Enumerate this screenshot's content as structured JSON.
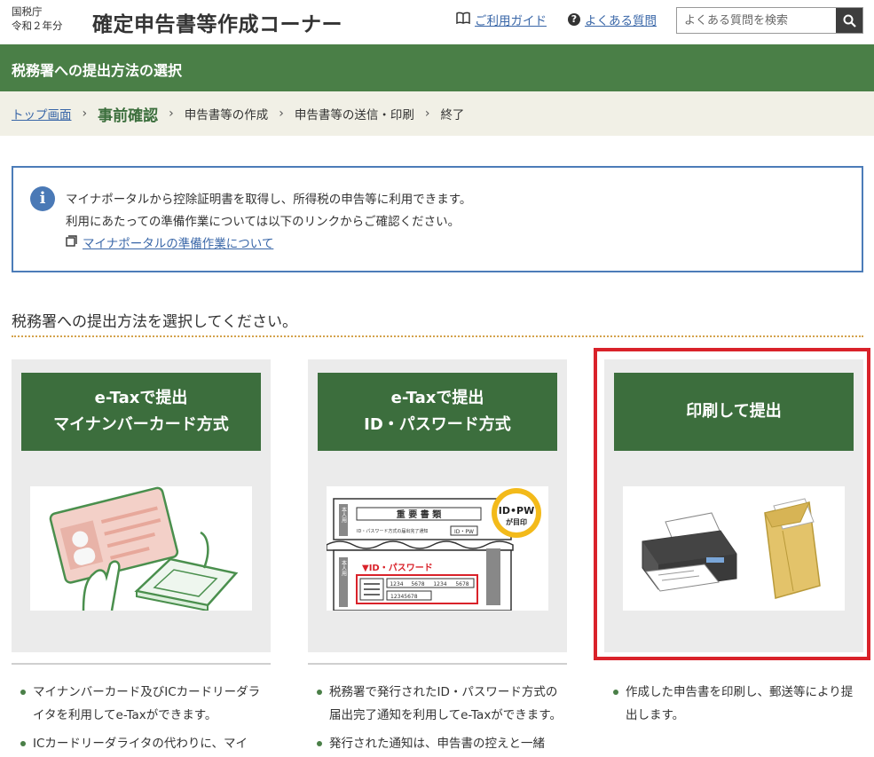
{
  "header": {
    "agency_line1": "国税庁",
    "agency_line2": "令和２年分",
    "title": "確定申告書等作成コーナー",
    "guide_link": "ご利用ガイド",
    "faq_link": "よくある質問",
    "search_placeholder": "よくある質問を検索"
  },
  "page_heading": "税務署への提出方法の選択",
  "breadcrumb": [
    "トップ画面",
    "事前確認",
    "申告書等の作成",
    "申告書等の送信・印刷",
    "終了"
  ],
  "info": {
    "line1": "マイナポータルから控除証明書を取得し、所得税の申告等に利用できます。",
    "line2": "利用にあたっての準備作業については以下のリンクからご確認ください。",
    "link": "マイナポータルの準備作業について"
  },
  "section_title": "税務署への提出方法を選択してください。",
  "cards": [
    {
      "line1": "e-Taxで提出",
      "line2": "マイナンバーカード方式",
      "bullets": [
        "マイナンバーカード及びICカードリーダライタを利用してe-Taxができます。",
        "ICカードリーダライタの代わりに、マイ"
      ]
    },
    {
      "line1": "e-Taxで提出",
      "line2": "ID・パスワード方式",
      "img_text": {
        "doc_title": "重 要 書 類",
        "doc_sub": "ID・パスワード方式の届出完了通知",
        "badge_top": "ID•PW",
        "badge_bottom": "が目印",
        "id_label": "▼ID・パスワード",
        "num1": "1234",
        "num2": "5678",
        "num3": "1234",
        "num4": "5678",
        "num_small": "12345678",
        "side_label": "本人用",
        "id_pw_tag": "ID・PW"
      },
      "bullets": [
        "税務署で発行されたID・パスワード方式の届出完了通知を利用してe-Taxができます。",
        "発行された通知は、申告書の控えと一緒"
      ]
    },
    {
      "line1": "印刷して提出",
      "line2": "",
      "bullets": [
        "作成した申告書を印刷し、郵送等により提出します。"
      ]
    }
  ],
  "colors": {
    "green_bar": "#4a7f47",
    "card_button": "#3c6e3d",
    "highlight": "#d9222a",
    "info_border": "#4c7cb8"
  }
}
